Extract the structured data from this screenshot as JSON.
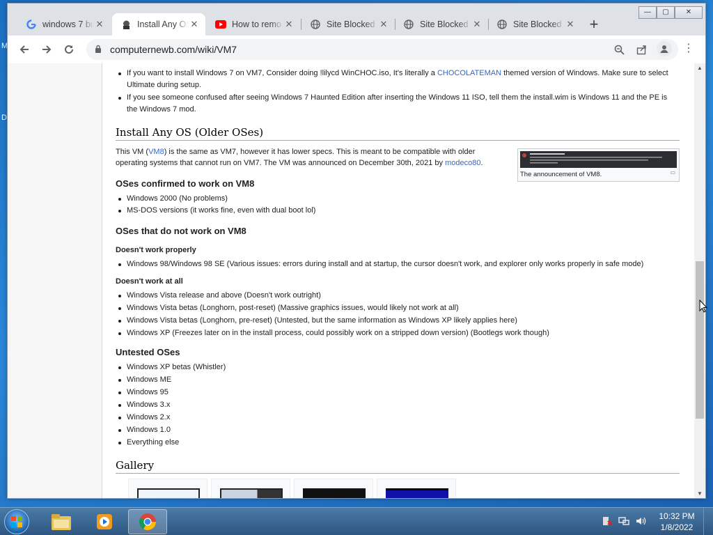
{
  "desktop": {
    "left_labels": [
      "M",
      "D"
    ]
  },
  "browser": {
    "tabs": [
      {
        "title": "windows 7 bu",
        "favicon": "google-icon",
        "active": false
      },
      {
        "title": "Install Any OS",
        "favicon": "site-icon",
        "active": true
      },
      {
        "title": "How to remo",
        "favicon": "youtube-icon",
        "active": false
      },
      {
        "title": "Site Blocked",
        "favicon": "globe-icon",
        "active": false
      },
      {
        "title": "Site Blocked",
        "favicon": "globe-icon",
        "active": false
      },
      {
        "title": "Site Blocked",
        "favicon": "globe-icon",
        "active": false
      }
    ],
    "new_tab_label": "+",
    "url": "computernewb.com/wiki/VM7",
    "window_controls": [
      "—",
      "▢",
      "✕"
    ]
  },
  "article": {
    "top_bullets": [
      {
        "pre": "If you want to install Windows 7 on VM7, Consider doing !lilycd WinCHOC.iso, It's literally a ",
        "link": "CHOCOLATEMAN",
        "post": " themed version of Windows. Make sure to select Ultimate during setup."
      },
      {
        "pre": "If you see someone confused after seeing Windows 7 Haunted Edition after inserting the Windows 11 ISO, tell them the install.wim is Windows 11 and the PE is the Windows 7 mod.",
        "link": "",
        "post": ""
      }
    ],
    "section_title": "Install Any OS (Older OSes)",
    "intro": {
      "p1": "This VM (",
      "link1": "VM8",
      "p2": ") is the same as VM7, however it has lower specs. This is meant to be compatible with older operating systems that cannot run on VM7. The VM was announced on December 30th, 2021 by ",
      "link2": "modeco80",
      "p3": "."
    },
    "thumb_caption": "The announcement of VM8.",
    "confirmed_title": "OSes confirmed to work on VM8",
    "confirmed": [
      "Windows 2000 (No problems)",
      "MS-DOS versions (it works fine, even with dual boot lol)"
    ],
    "not_work_title": "OSes that do not work on VM8",
    "not_properly_title": "Doesn't work properly",
    "not_properly": [
      "Windows 98/Windows 98 SE (Various issues: errors during install and at startup, the cursor doesn't work, and explorer only works properly in safe mode)"
    ],
    "not_at_all_title": "Doesn't work at all",
    "not_at_all": [
      "Windows Vista release and above (Doesn't work outright)",
      "Windows Vista betas (Longhorn, post-reset) (Massive graphics issues, would likely not work at all)",
      "Windows Vista betas (Longhorn, pre-reset) (Untested, but the same information as Windows XP likely applies here)",
      "Windows XP (Freezes later on in the install process, could possibly work on a stripped down version) (Bootlegs work though)"
    ],
    "untested_title": "Untested OSes",
    "untested": [
      "Windows XP betas (Whistler)",
      "Windows ME",
      "Windows 95",
      "Windows 3.x",
      "Windows 2.x",
      "Windows 1.0",
      "Everything else"
    ],
    "gallery_title": "Gallery"
  },
  "taskbar": {
    "time": "10:32 PM",
    "date": "1/8/2022",
    "items": [
      "explorer-icon",
      "media-player-icon",
      "chrome-icon"
    ]
  },
  "colors": {
    "link": "#3366cc",
    "taskbar": "#2e5680"
  }
}
